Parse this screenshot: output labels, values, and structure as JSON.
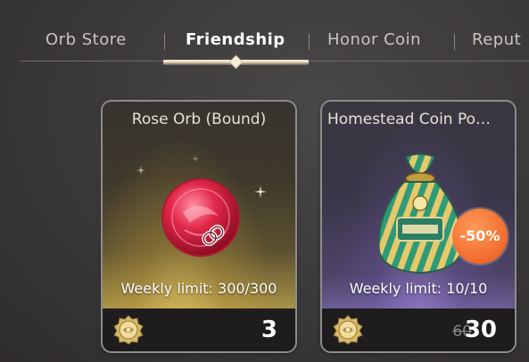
{
  "tabs": {
    "items": [
      {
        "label": "Orb Store"
      },
      {
        "label": "Friendship"
      },
      {
        "label": "Honor Coin"
      },
      {
        "label": "Reput"
      }
    ],
    "active": "Friendship"
  },
  "items": [
    {
      "name": "Rose Orb (Bound)",
      "weekly_limit": "Weekly limit: 300/300",
      "price": "3",
      "icon": "rose-orb-icon",
      "currency_icon": "friendship-coin-icon"
    },
    {
      "name": "Homestead Coin Po…",
      "weekly_limit": "Weekly limit: 10/10",
      "price": "30",
      "old_price": "60",
      "discount": "-50%",
      "icon": "coin-pouch-icon",
      "currency_icon": "friendship-coin-icon"
    }
  ],
  "colors": {
    "background": "#3b3839",
    "gold_card": "#c5ad57",
    "purple_card": "#7768a8",
    "discount": "#f26a2c"
  }
}
